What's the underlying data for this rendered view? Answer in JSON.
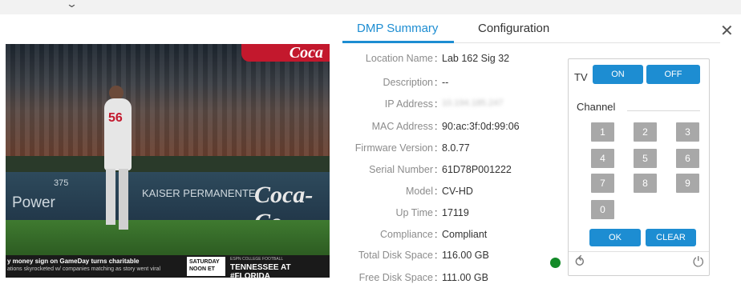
{
  "topbar": {
    "chevron_icon": "chevron-down-icon",
    "chevron_glyph": "⌄"
  },
  "video": {
    "banner_text": "Coca",
    "board_power": "Power",
    "board_number": "375",
    "board_kaiser": "KAISER PERMANENTE.",
    "board_coke": "Coca-Co",
    "player_number": "56",
    "ticker_line1": "y money sign on GameDay turns charitable",
    "ticker_line2": "ations skyrocketed w/ companies matching as story went viral",
    "ticker_saturday": "SATURDAY NOON ET",
    "ticker_espn": "ESPN COLLEGE FOOTBALL",
    "ticker_game": "TENNESSEE AT #FLORIDA"
  },
  "tabs": [
    {
      "label": "DMP Summary",
      "active": true
    },
    {
      "label": "Configuration",
      "active": false
    }
  ],
  "close_glyph": "✕",
  "summary": {
    "rows": [
      {
        "label": "Location Name",
        "value": "Lab 162 Sig 32"
      },
      {
        "label": "Description",
        "value": "--"
      },
      {
        "label": "IP Address",
        "value": "10.194.185.247",
        "blurred": true
      },
      {
        "label": "MAC Address",
        "value": "90:ac:3f:0d:99:06"
      },
      {
        "label": "Firmware Version",
        "value": "8.0.77"
      },
      {
        "label": "Serial Number",
        "value": "61D78P001222"
      },
      {
        "label": "Model",
        "value": "CV-HD"
      },
      {
        "label": "Up Time",
        "value": "17119"
      },
      {
        "label": "Compliance",
        "value": "Compliant"
      },
      {
        "label": "Total Disk Space",
        "value": "116.00 GB"
      },
      {
        "label": "Free Disk Space",
        "value": "111.00 GB"
      }
    ],
    "colon": ":"
  },
  "status": {
    "color": "#138a28"
  },
  "remote": {
    "tv_label": "TV",
    "on_label": "ON",
    "off_label": "OFF",
    "channel_label": "Channel",
    "keys": [
      "1",
      "2",
      "3",
      "4",
      "5",
      "6",
      "7",
      "8",
      "9",
      "0"
    ],
    "ok_label": "OK",
    "clear_label": "CLEAR",
    "refresh_glyph": "⥀",
    "power_glyph": "⏻"
  },
  "colors": {
    "accent": "#1d8dd2",
    "key_gray": "#a8a8a8"
  }
}
